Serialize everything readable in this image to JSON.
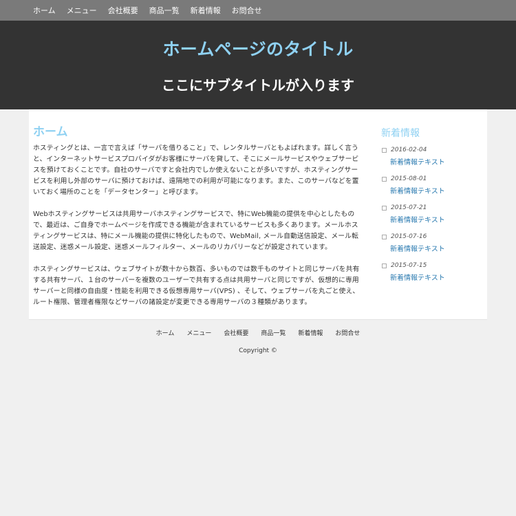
{
  "nav": {
    "items": [
      "ホーム",
      "メニュー",
      "会社概要",
      "商品一覧",
      "新着情報",
      "お問合せ"
    ]
  },
  "hero": {
    "title": "ホームページのタイトル",
    "subtitle": "ここにサブタイトルが入ります"
  },
  "content": {
    "heading": "ホーム",
    "paragraphs": [
      "ホスティングとは、一言で言えば「サーバを借りること」で、レンタルサーバともよばれます。詳しく言うと、インターネットサービスプロバイダがお客様にサーバを貸して、そこにメールサービスやウェブサービスを預けておくことです。自社のサーバですと会社内でしか使えないことが多いですが、ホスティングサービスを利用し外部のサーバに預けておけば、遠隔地での利用が可能になります。また、このサーバなどを置いておく場所のことを「データセンター」と呼びます。",
      "Webホスティングサービスは共用サーバホスティングサービスで、特にWeb機能の提供を中心としたもので、最近は、ご自身でホームページを作成できる機能が含まれているサービスも多くあります。メールホスティングサービスは、特にメール機能の提供に特化したもので、WebMail, メール自動送信設定、メール転送設定、迷惑メール設定、迷惑メールフィルター、メールのリカバリーなどが設定されています。",
      "ホスティングサービスは、ウェブサイトが数十から数百、多いものでは数千ものサイトと同じサーバを共有する共有サーバ、１台のサーバーを複数のユーザーで共有する点は共用サーバと同じですが、仮想的に専用サーバーと同様の自由度・性能を利用できる仮想専用サーバ(VPS) 、そして、ウェブサーバを丸ごと使え、ルート権限、管理者権限などサーバの諸設定が変更できる専用サーバの３種類があります。"
    ]
  },
  "sidebar": {
    "heading": "新着情報",
    "items": [
      {
        "date": "2016-02-04",
        "link": "新着情報テキスト"
      },
      {
        "date": "2015-08-01",
        "link": "新着情報テキスト"
      },
      {
        "date": "2015-07-21",
        "link": "新着情報テキスト"
      },
      {
        "date": "2015-07-16",
        "link": "新着情報テキスト"
      },
      {
        "date": "2015-07-15",
        "link": "新着情報テキスト"
      }
    ]
  },
  "footer": {
    "items": [
      "ホーム",
      "メニュー",
      "会社概要",
      "商品一覧",
      "新着情報",
      "お問合せ"
    ],
    "copyright": "Copyright ©"
  },
  "colors": {
    "accent": "#8fd1f2",
    "hero_bg": "#333333",
    "nav_bg": "#7a7a7a",
    "link": "#2a7ab0"
  }
}
